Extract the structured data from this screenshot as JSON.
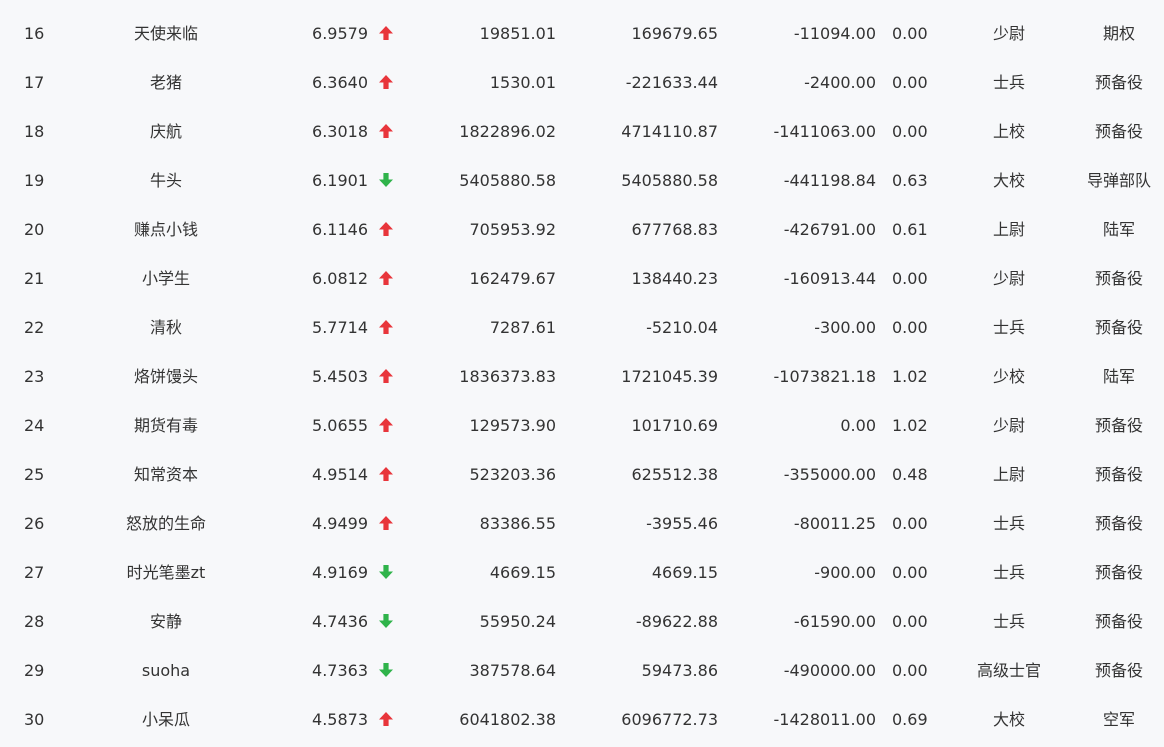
{
  "colors": {
    "up": "#e8353b",
    "down": "#2fb34a",
    "text": "#333333",
    "background": "#f7f8fa"
  },
  "rows": [
    {
      "rank": "16",
      "name": "天使来临",
      "score": "6.9579",
      "trend": "up",
      "assets": "19851.01",
      "profit": "169679.65",
      "withdraw": "-11094.00",
      "ratio": "0.00",
      "title": "少尉",
      "unit": "期权"
    },
    {
      "rank": "17",
      "name": "老猪",
      "score": "6.3640",
      "trend": "up",
      "assets": "1530.01",
      "profit": "-221633.44",
      "withdraw": "-2400.00",
      "ratio": "0.00",
      "title": "士兵",
      "unit": "预备役"
    },
    {
      "rank": "18",
      "name": "庆航",
      "score": "6.3018",
      "trend": "up",
      "assets": "1822896.02",
      "profit": "4714110.87",
      "withdraw": "-1411063.00",
      "ratio": "0.00",
      "title": "上校",
      "unit": "预备役"
    },
    {
      "rank": "19",
      "name": "牛头",
      "score": "6.1901",
      "trend": "down",
      "assets": "5405880.58",
      "profit": "5405880.58",
      "withdraw": "-441198.84",
      "ratio": "0.63",
      "title": "大校",
      "unit": "导弹部队"
    },
    {
      "rank": "20",
      "name": "赚点小钱",
      "score": "6.1146",
      "trend": "up",
      "assets": "705953.92",
      "profit": "677768.83",
      "withdraw": "-426791.00",
      "ratio": "0.61",
      "title": "上尉",
      "unit": "陆军"
    },
    {
      "rank": "21",
      "name": "小学生",
      "score": "6.0812",
      "trend": "up",
      "assets": "162479.67",
      "profit": "138440.23",
      "withdraw": "-160913.44",
      "ratio": "0.00",
      "title": "少尉",
      "unit": "预备役"
    },
    {
      "rank": "22",
      "name": "清秋",
      "score": "5.7714",
      "trend": "up",
      "assets": "7287.61",
      "profit": "-5210.04",
      "withdraw": "-300.00",
      "ratio": "0.00",
      "title": "士兵",
      "unit": "预备役"
    },
    {
      "rank": "23",
      "name": "烙饼馒头",
      "score": "5.4503",
      "trend": "up",
      "assets": "1836373.83",
      "profit": "1721045.39",
      "withdraw": "-1073821.18",
      "ratio": "1.02",
      "title": "少校",
      "unit": "陆军"
    },
    {
      "rank": "24",
      "name": "期货有毒",
      "score": "5.0655",
      "trend": "up",
      "assets": "129573.90",
      "profit": "101710.69",
      "withdraw": "0.00",
      "ratio": "1.02",
      "title": "少尉",
      "unit": "预备役"
    },
    {
      "rank": "25",
      "name": "知常资本",
      "score": "4.9514",
      "trend": "up",
      "assets": "523203.36",
      "profit": "625512.38",
      "withdraw": "-355000.00",
      "ratio": "0.48",
      "title": "上尉",
      "unit": "预备役"
    },
    {
      "rank": "26",
      "name": "怒放的生命",
      "score": "4.9499",
      "trend": "up",
      "assets": "83386.55",
      "profit": "-3955.46",
      "withdraw": "-80011.25",
      "ratio": "0.00",
      "title": "士兵",
      "unit": "预备役"
    },
    {
      "rank": "27",
      "name": "时光笔墨zt",
      "score": "4.9169",
      "trend": "down",
      "assets": "4669.15",
      "profit": "4669.15",
      "withdraw": "-900.00",
      "ratio": "0.00",
      "title": "士兵",
      "unit": "预备役"
    },
    {
      "rank": "28",
      "name": "安静",
      "score": "4.7436",
      "trend": "down",
      "assets": "55950.24",
      "profit": "-89622.88",
      "withdraw": "-61590.00",
      "ratio": "0.00",
      "title": "士兵",
      "unit": "预备役"
    },
    {
      "rank": "29",
      "name": "suoha",
      "score": "4.7363",
      "trend": "down",
      "assets": "387578.64",
      "profit": "59473.86",
      "withdraw": "-490000.00",
      "ratio": "0.00",
      "title": "高级士官",
      "unit": "预备役"
    },
    {
      "rank": "30",
      "name": "小呆瓜",
      "score": "4.5873",
      "trend": "up",
      "assets": "6041802.38",
      "profit": "6096772.73",
      "withdraw": "-1428011.00",
      "ratio": "0.69",
      "title": "大校",
      "unit": "空军"
    }
  ]
}
